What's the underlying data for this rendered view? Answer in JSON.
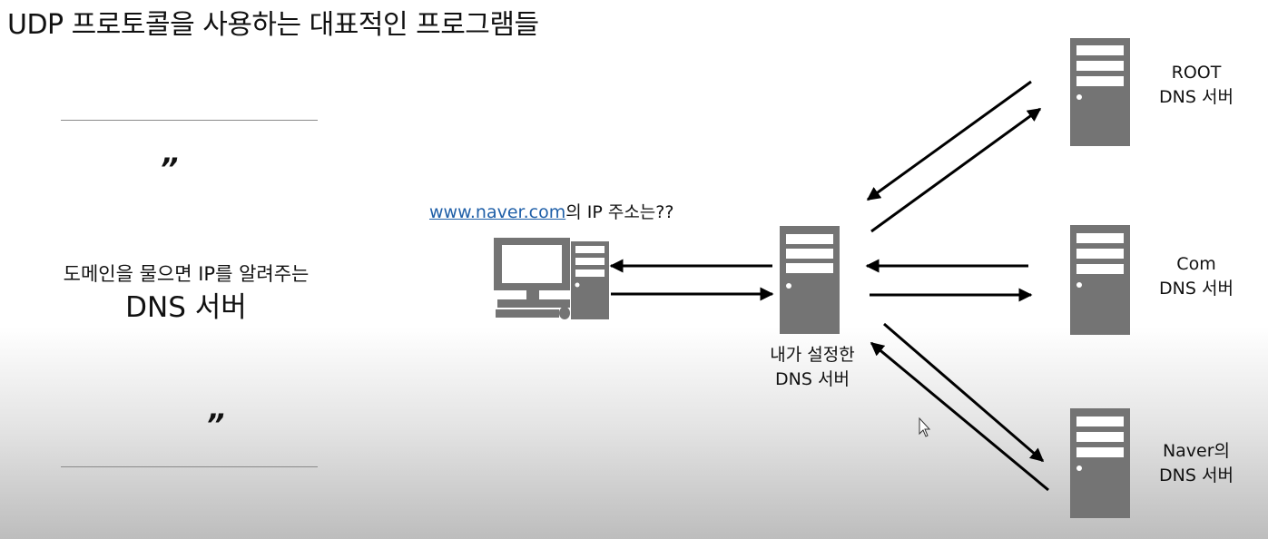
{
  "title": "UDP 프로토콜을 사용하는 대표적인 프로그램들",
  "quote_block": {
    "open_quote": "”",
    "close_quote": "”",
    "subtitle": "도메인을 물으면  IP를 알려주는",
    "heading": "DNS 서버"
  },
  "diagram": {
    "query_link": "www.naver.com",
    "query_rest": "의 IP 주소는??",
    "local_dns_line1": "내가 설정한",
    "local_dns_line2": "DNS 서버",
    "root_line1": "ROOT",
    "root_line2": "DNS 서버",
    "com_line1": "Com",
    "com_line2": "DNS 서버",
    "naver_line1": "Naver의",
    "naver_line2": "DNS 서버"
  },
  "colors": {
    "server_fill": "#747474",
    "server_slot": "#ffffff",
    "link": "#1f5fa8",
    "arrow": "#000000"
  }
}
